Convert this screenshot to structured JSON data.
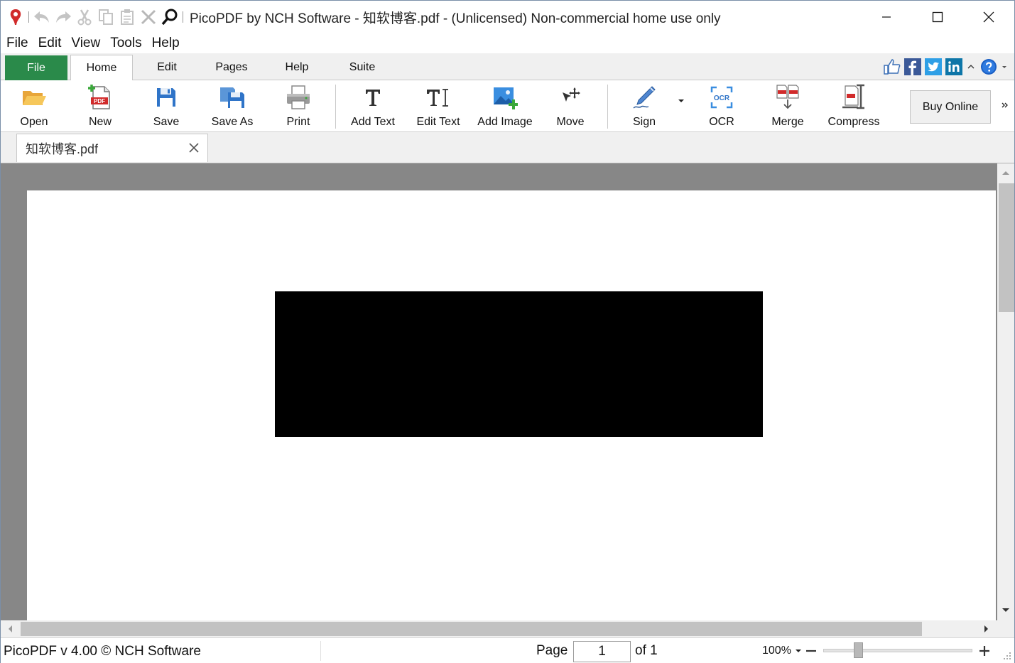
{
  "window": {
    "title": "PicoPDF by NCH Software - 知软博客.pdf - (Unlicensed) Non-commercial home use only"
  },
  "menu": [
    "File",
    "Edit",
    "View",
    "Tools",
    "Help"
  ],
  "tabs": {
    "file": "File",
    "home": "Home",
    "edit": "Edit",
    "pages": "Pages",
    "help": "Help",
    "suite": "Suite"
  },
  "toolbar": {
    "open": "Open",
    "new": "New",
    "save": "Save",
    "save_as": "Save As",
    "print": "Print",
    "add_text": "Add Text",
    "edit_text": "Edit Text",
    "add_image": "Add Image",
    "move": "Move",
    "sign": "Sign",
    "ocr": "OCR",
    "merge": "Merge",
    "compress": "Compress",
    "buy_online": "Buy Online"
  },
  "icons": {
    "new_badge": "PDF",
    "ocr_badge": "OCR"
  },
  "document": {
    "tab_name": "知软博客.pdf"
  },
  "status": {
    "version": "PicoPDF v 4.00 © NCH Software",
    "page_label": "Page",
    "page_value": "1",
    "page_of": "of 1",
    "zoom": "100%",
    "zoom_level_fraction": 0.22
  },
  "colors": {
    "file_tab": "#2a8a4a",
    "viewer_bg": "#878787",
    "redaction": "#000000"
  }
}
